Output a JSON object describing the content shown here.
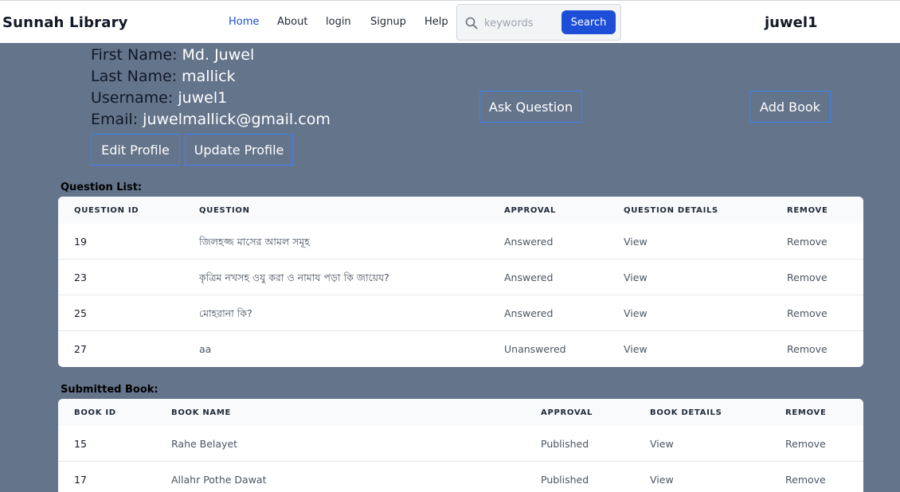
{
  "navbar": {
    "brand": "Sunnah Library",
    "links": [
      "Home",
      "About",
      "login",
      "Signup",
      "Help"
    ],
    "search_placeholder": "keywords",
    "search_button": "Search",
    "user": "juwel1"
  },
  "profile": {
    "first_name_label": "First Name:",
    "first_name": "Md. Juwel",
    "last_name_label": "Last Name:",
    "last_name": "mallick",
    "username_label": "Username:",
    "username": "juwel1",
    "email_label": "Email:",
    "email": "juwelmallick@gmail.com",
    "edit_button": "Edit Profile",
    "update_button": "Update Profile",
    "ask_button": "Ask Question",
    "add_book_button": "Add Book"
  },
  "questions": {
    "title": "Question List:",
    "headers": [
      "QUESTION ID",
      "QUESTION",
      "APPROVAL",
      "QUESTION DETAILS",
      "REMOVE"
    ],
    "rows": [
      {
        "id": "19",
        "question": "জিলহজ্জ মাসের আমল সমূহ",
        "approval": "Answered",
        "details": "View",
        "remove": "Remove"
      },
      {
        "id": "23",
        "question": "কৃত্রিম নখসহ ওযু করা ও নামায পড়া কি জায়েয?",
        "approval": "Answered",
        "details": "View",
        "remove": "Remove"
      },
      {
        "id": "25",
        "question": "মোহরানা কি?",
        "approval": "Answered",
        "details": "View",
        "remove": "Remove"
      },
      {
        "id": "27",
        "question": "aa",
        "approval": "Unanswered",
        "details": "View",
        "remove": "Remove"
      }
    ]
  },
  "books": {
    "title": "Submitted Book:",
    "headers": [
      "BOOK ID",
      "BOOK NAME",
      "APPROVAL",
      "BOOK DETAILS",
      "REMOVE"
    ],
    "rows": [
      {
        "id": "15",
        "name": "Rahe Belayet",
        "approval": "Published",
        "details": "View",
        "remove": "Remove"
      },
      {
        "id": "17",
        "name": "Allahr Pothe Dawat",
        "approval": "Published",
        "details": "View",
        "remove": "Remove"
      }
    ]
  }
}
